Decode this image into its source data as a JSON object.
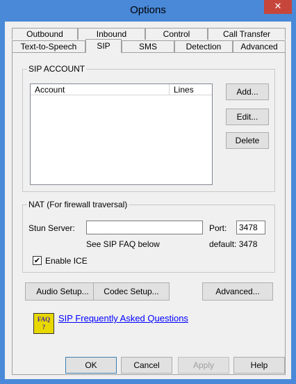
{
  "window": {
    "title": "Options",
    "close_glyph": "✕"
  },
  "tabs": {
    "row1": [
      "Outbound",
      "Inbound",
      "Control",
      "Call Transfer"
    ],
    "row2": [
      "Text-to-Speech",
      "SIP",
      "SMS",
      "Detection",
      "Advanced"
    ],
    "selected": "SIP"
  },
  "sip_account": {
    "group_label": "SIP ACCOUNT",
    "columns": [
      "Account",
      "Lines"
    ],
    "buttons": {
      "add": "Add...",
      "edit": "Edit...",
      "delete": "Delete"
    }
  },
  "nat": {
    "group_label": "NAT (For firewall traversal)",
    "stun_label": "Stun Server:",
    "stun_value": "",
    "faq_hint": "See SIP FAQ below",
    "port_label": "Port:",
    "port_value": "3478",
    "default_text": "default: 3478",
    "enable_ice_label": "Enable ICE",
    "enable_ice_checked": "✔"
  },
  "setup_buttons": {
    "audio": "Audio Setup...",
    "codec": "Codec Setup...",
    "advanced": "Advanced..."
  },
  "faq": {
    "icon_text_top": "FAQ",
    "icon_text_bottom": "?",
    "link": "SIP Frequently Asked Questions"
  },
  "footer": {
    "ok": "OK",
    "cancel": "Cancel",
    "apply": "Apply",
    "help": "Help"
  }
}
